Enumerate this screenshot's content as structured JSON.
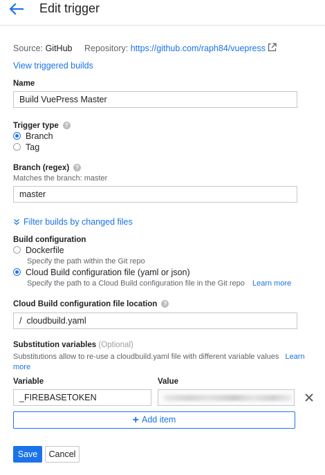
{
  "header": {
    "title": "Edit trigger",
    "back_icon": "arrow-left-icon"
  },
  "meta": {
    "source_label": "Source:",
    "source_value": "GitHub",
    "repo_label": "Repository:",
    "repo_url": "https://github.com/raph84/vuepress",
    "external_icon": "open-in-new-icon",
    "view_builds": "View triggered builds"
  },
  "name": {
    "label": "Name",
    "value": "Build VuePress Master"
  },
  "trigger_type": {
    "label": "Trigger type",
    "help_icon": "help-icon",
    "options": [
      {
        "label": "Branch",
        "checked": true
      },
      {
        "label": "Tag",
        "checked": false
      }
    ]
  },
  "branch": {
    "label": "Branch (regex)",
    "hint": "Matches the branch: master",
    "value": "master"
  },
  "filter": {
    "icon": "chevron-double-down-icon",
    "label": "Filter builds by changed files"
  },
  "build_config": {
    "label": "Build configuration",
    "options": [
      {
        "label": "Dockerfile",
        "hint": "Specify the path within the Git repo",
        "checked": false
      },
      {
        "label": "Cloud Build configuration file (yaml or json)",
        "hint": "Specify the path to a Cloud Build configuration file in the Git repo",
        "checked": true
      }
    ],
    "learn_more": "Learn more"
  },
  "config_location": {
    "label": "Cloud Build configuration file location",
    "prefix": "/",
    "value": "cloudbuild.yaml"
  },
  "substitution": {
    "label": "Substitution variables",
    "optional": "(Optional)",
    "desc": "Substitutions allow to re-use a cloudbuild.yaml file with different variable values",
    "learn_more": "Learn more",
    "variable_header": "Variable",
    "value_header": "Value",
    "variable_value": "_FIREBASETOKEN",
    "remove_icon": "close-icon",
    "add_item": "Add item",
    "add_icon": "plus-icon"
  },
  "actions": {
    "save": "Save",
    "cancel": "Cancel"
  },
  "colors": {
    "accent": "#1a73e8",
    "border": "#c6c6c6",
    "muted_text": "#5f6368"
  }
}
